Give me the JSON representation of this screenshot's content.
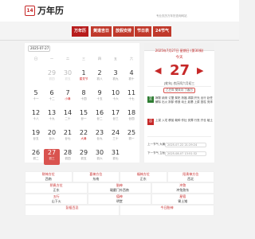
{
  "header": {
    "logo_glyph": "14",
    "app_name": "万年历",
    "slogan": "专业农历万年历查询网站"
  },
  "nav": {
    "items": [
      {
        "label": "万年历"
      },
      {
        "label": "黄道吉日"
      },
      {
        "label": "放假安排"
      },
      {
        "label": "节日表"
      },
      {
        "label": "24节气"
      }
    ]
  },
  "calendar": {
    "selected_month": "2025-07-27",
    "weekdays": [
      "日",
      "一",
      "二",
      "三",
      "四",
      "五",
      "六"
    ],
    "days": [
      {
        "num": "29",
        "sub": "初四",
        "state": "faded"
      },
      {
        "num": "30",
        "sub": "初五",
        "state": "faded"
      },
      {
        "num": "1",
        "sub": "建党节",
        "state": "festival"
      },
      {
        "num": "2",
        "sub": "初八",
        "state": ""
      },
      {
        "num": "3",
        "sub": "初九",
        "state": ""
      },
      {
        "num": "4",
        "sub": "初十",
        "state": ""
      },
      {
        "num": "5",
        "sub": "十一",
        "state": ""
      },
      {
        "num": "6",
        "sub": "十二",
        "state": ""
      },
      {
        "num": "7",
        "sub": "小暑",
        "state": "festival"
      },
      {
        "num": "8",
        "sub": "十四",
        "state": ""
      },
      {
        "num": "9",
        "sub": "十五",
        "state": ""
      },
      {
        "num": "10",
        "sub": "十六",
        "state": ""
      },
      {
        "num": "11",
        "sub": "十七",
        "state": ""
      },
      {
        "num": "12",
        "sub": "十八",
        "state": ""
      },
      {
        "num": "13",
        "sub": "十九",
        "state": ""
      },
      {
        "num": "14",
        "sub": "二十",
        "state": ""
      },
      {
        "num": "15",
        "sub": "廿一",
        "state": ""
      },
      {
        "num": "16",
        "sub": "廿二",
        "state": ""
      },
      {
        "num": "17",
        "sub": "廿三",
        "state": ""
      },
      {
        "num": "18",
        "sub": "廿四",
        "state": ""
      },
      {
        "num": "19",
        "sub": "廿五",
        "state": ""
      },
      {
        "num": "20",
        "sub": "廿六",
        "state": ""
      },
      {
        "num": "21",
        "sub": "廿七",
        "state": ""
      },
      {
        "num": "22",
        "sub": "大暑",
        "state": "festival"
      },
      {
        "num": "23",
        "sub": "廿九",
        "state": ""
      },
      {
        "num": "24",
        "sub": "三十",
        "state": ""
      },
      {
        "num": "25",
        "sub": "初一",
        "state": ""
      },
      {
        "num": "26",
        "sub": "初二",
        "state": ""
      },
      {
        "num": "27",
        "sub": "初三",
        "state": "selected"
      },
      {
        "num": "28",
        "sub": "初四",
        "state": ""
      },
      {
        "num": "29",
        "sub": "初五",
        "state": ""
      },
      {
        "num": "30",
        "sub": "初六",
        "state": ""
      },
      {
        "num": "31",
        "sub": "初七",
        "state": ""
      }
    ]
  },
  "detail": {
    "full_date": "2025年7月27日 星期日 (第30周)",
    "weekday": "今天",
    "day": "27",
    "prev_arrow": "◀",
    "next_arrow": "▶",
    "lunar_year": "[蛇年] 农历闰六月初三",
    "ganzhi": "乙巳年 癸未月 丁酉日",
    "yi_badge": "宜",
    "yi_text": "嫁娶 纳采 订盟 祭祀 祈福 求嗣 开光 出行 赴任 解除 出火 拆卸 修造 动土 起基 上梁 竖柱 安床",
    "ji_badge": "忌",
    "ji_text": "上梁 入宅 移徙 栽种 作灶 安葬 行丧 开仓 破土",
    "prev_jieqi_label": "上一节气",
    "prev_jieqi_value": "大暑",
    "prev_jieqi_date": "2025-07-22 21:29:24",
    "next_jieqi_label": "下一节气",
    "next_jieqi_value": "立秋",
    "next_jieqi_date": "2025-08-07 13:51:32"
  },
  "info": {
    "row1": [
      {
        "label": "财神方位",
        "value": "西南"
      },
      {
        "label": "喜神方位",
        "value": "东南"
      },
      {
        "label": "福神方位",
        "value": "正东"
      },
      {
        "label": "阳贵神方位",
        "value": "西北"
      }
    ],
    "row2": [
      {
        "label": "阴贵方位",
        "value": "正东"
      },
      {
        "label": "胎神",
        "value": "碓磨门外西南"
      },
      {
        "label": "冲煞",
        "value": "冲兔煞东"
      }
    ],
    "row3": [
      {
        "label": "五行",
        "value": "山下火"
      },
      {
        "label": "值神",
        "value": "明堂"
      },
      {
        "label": "星宿",
        "value": "胃土雉"
      }
    ],
    "row4": [
      {
        "label": "彭祖百忌",
        "value": ""
      },
      {
        "label": "今日胎神",
        "value": ""
      }
    ]
  },
  "colors": {
    "accent": "#c62828",
    "nav_red": "#c0392b",
    "selected_day": "#d9534f"
  }
}
